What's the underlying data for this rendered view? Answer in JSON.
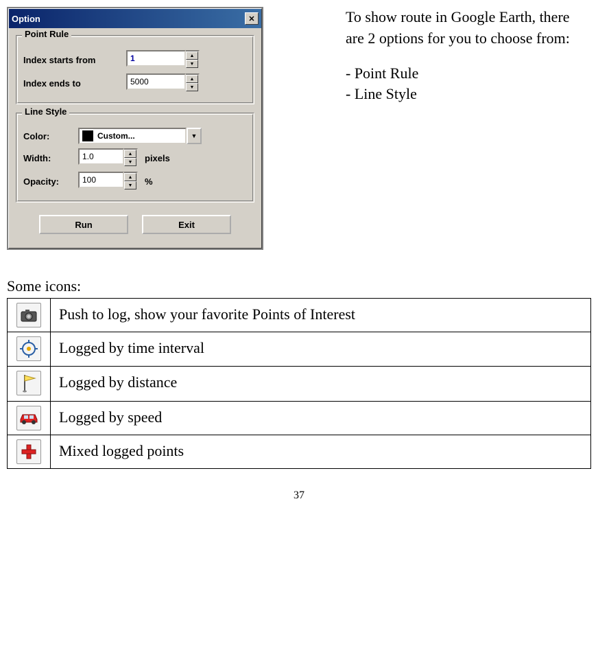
{
  "dialog": {
    "title": "Option",
    "point_rule": {
      "legend": "Point Rule",
      "index_starts_label": "Index starts from",
      "index_starts_value": "1",
      "index_ends_label": "Index ends to",
      "index_ends_value": "5000"
    },
    "line_style": {
      "legend": "Line Style",
      "color_label": "Color:",
      "color_value": "Custom...",
      "color_hex": "#000000",
      "width_label": "Width:",
      "width_value": "1.0",
      "width_unit": "pixels",
      "opacity_label": "Opacity:",
      "opacity_value": "100",
      "opacity_unit": "%"
    },
    "buttons": {
      "run": "Run",
      "exit": "Exit"
    }
  },
  "side_text": {
    "intro": "To show route in Google Earth, there are 2 options for you to choose from:",
    "opt1": "- Point Rule",
    "opt2": "- Line Style"
  },
  "icons_section": {
    "heading": "Some icons:",
    "rows": [
      {
        "icon": "camera-icon",
        "desc": "Push to log, show your favorite Points of Interest"
      },
      {
        "icon": "target-icon",
        "desc": "Logged by time interval"
      },
      {
        "icon": "flag-icon",
        "desc": "Logged by distance"
      },
      {
        "icon": "car-icon",
        "desc": "Logged by speed"
      },
      {
        "icon": "plus-icon",
        "desc": "Mixed logged points"
      }
    ]
  },
  "page_number": "37"
}
